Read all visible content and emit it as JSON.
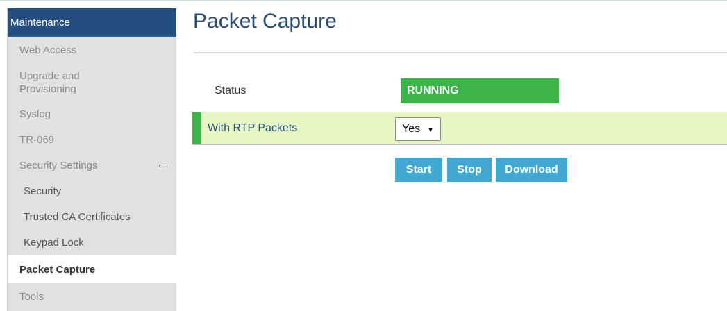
{
  "sidebar": {
    "header": "Maintenance",
    "items": [
      {
        "label": "Web Access"
      },
      {
        "label": "Upgrade and Provisioning"
      },
      {
        "label": "Syslog"
      },
      {
        "label": "TR-069"
      },
      {
        "label": "Security Settings"
      },
      {
        "label": "Security"
      },
      {
        "label": "Trusted CA Certificates"
      },
      {
        "label": "Keypad Lock"
      },
      {
        "label": "Packet Capture"
      },
      {
        "label": "Tools"
      }
    ]
  },
  "main": {
    "title": "Packet Capture",
    "status_label": "Status",
    "status_value": "RUNNING",
    "rtp_label": "With RTP Packets",
    "rtp_selected": "Yes",
    "buttons": {
      "start": "Start",
      "stop": "Stop",
      "download": "Download"
    }
  },
  "colors": {
    "sidebar_header": "#244e7e",
    "status_running": "#3cb44a",
    "button": "#43a8d1",
    "row_highlight": "#e6f7c4"
  }
}
